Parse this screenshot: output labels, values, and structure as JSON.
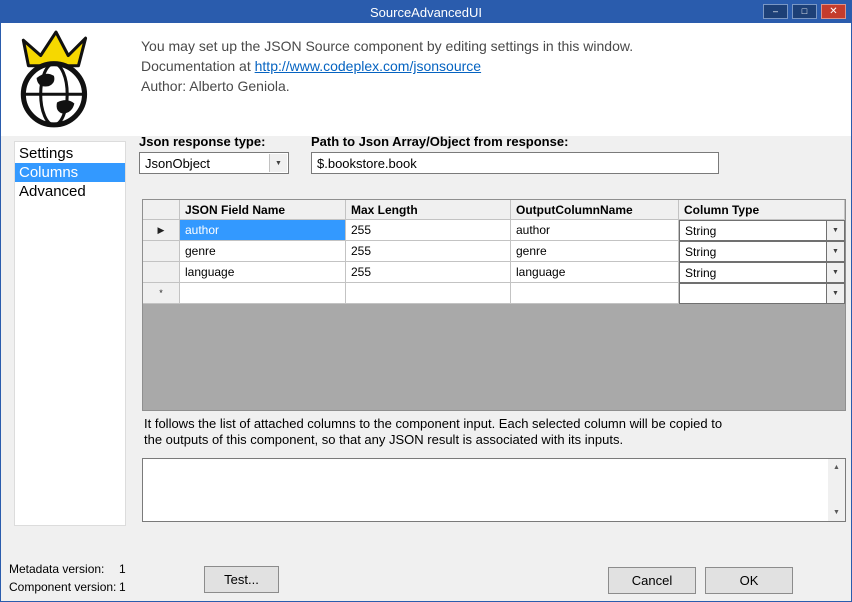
{
  "window": {
    "title": "SourceAdvancedUI"
  },
  "icons": {
    "minimize": "–",
    "maximize": "□",
    "close": "✕",
    "dropdown": "▼",
    "scroll_up": "▲",
    "scroll_down": "▼"
  },
  "header": {
    "line1": "You may set up the JSON Source component by editing settings in this window.",
    "line2_prefix": "Documentation at ",
    "link": "http://www.codeplex.com/jsonsource",
    "line3": "Author: Alberto Geniola."
  },
  "sidebar": {
    "items": [
      {
        "label": "Settings",
        "selected": false
      },
      {
        "label": "Columns",
        "selected": true
      },
      {
        "label": "Advanced",
        "selected": false
      }
    ]
  },
  "form": {
    "response_type_label": "Json response type:",
    "response_type_value": "JsonObject",
    "path_label": "Path to Json Array/Object from response:",
    "path_value": "$.bookstore.book"
  },
  "grid": {
    "headers": [
      "JSON Field Name",
      "Max Length",
      "OutputColumnName",
      "Column Type"
    ],
    "rows": [
      {
        "selector": "▶",
        "field": "author",
        "max_length": "255",
        "output": "author",
        "type": "String"
      },
      {
        "selector": "",
        "field": "genre",
        "max_length": "255",
        "output": "genre",
        "type": "String"
      },
      {
        "selector": "",
        "field": "language",
        "max_length": "255",
        "output": "language",
        "type": "String"
      },
      {
        "selector": "*",
        "field": "",
        "max_length": "",
        "output": "",
        "type": ""
      }
    ]
  },
  "description": {
    "line1": "It follows the list of attached columns to the component input. Each selected column will be copied to",
    "line2": "the outputs of this component, so that any JSON result is associated with its inputs."
  },
  "footer": {
    "metadata_label": "Metadata version:",
    "metadata_value": "1",
    "component_label": "Component version:",
    "component_value": "1",
    "test_label": "Test...",
    "cancel_label": "Cancel",
    "ok_label": "OK"
  },
  "colors": {
    "titlebar": "#2a5cad",
    "selection": "#3399ff",
    "close_button": "#c43c2c",
    "link": "#0563c1"
  }
}
